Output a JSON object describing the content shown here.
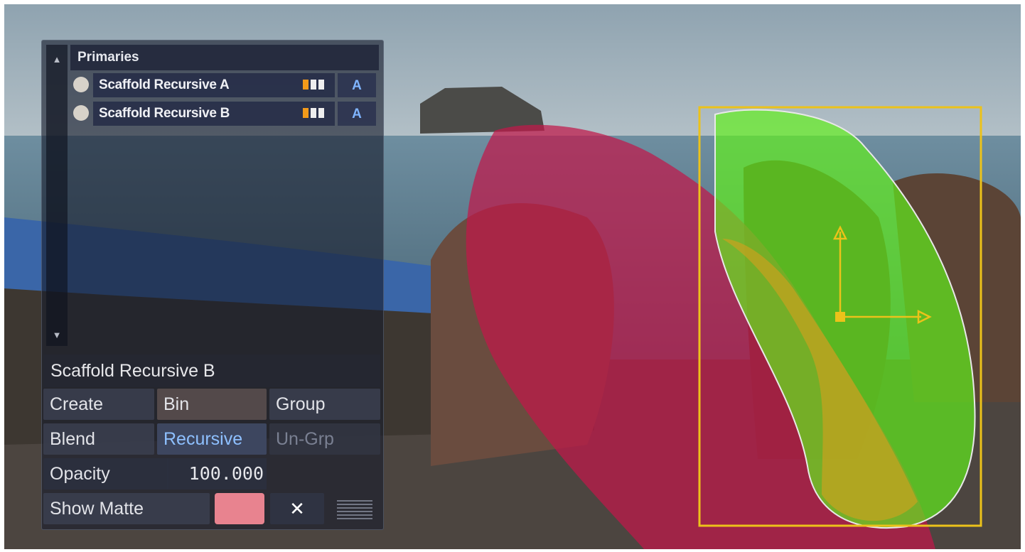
{
  "panel": {
    "list_header": "Primaries",
    "scroll_up_glyph": "▲",
    "scroll_down_glyph": "▼",
    "items": [
      {
        "name": "Scaffold Recursive A",
        "flag": "A",
        "status_icon": "circle-icon",
        "bar_icon": "level-bars-icon"
      },
      {
        "name": "Scaffold Recursive B",
        "flag": "A",
        "status_icon": "circle-icon",
        "bar_icon": "level-bars-icon"
      }
    ],
    "selected_name": "Scaffold Recursive B",
    "buttons": {
      "create": "Create",
      "bin": "Bin",
      "group": "Group",
      "blend": "Blend",
      "recursive": "Recursive",
      "ungroup": "Un-Grp",
      "show_matte": "Show Matte",
      "close_glyph": "✕"
    },
    "opacity": {
      "label": "Opacity",
      "value": "100.000"
    },
    "matte_color": "#e8838f"
  },
  "colors": {
    "accent_blue": "#8ec0ff",
    "bar_orange": "#f29a1a",
    "bar_white": "#eeeeee",
    "shape_red": "#c0174a",
    "shape_green": "#62f21a",
    "shape_yellow": "#c8a21e",
    "box_outline": "#ecc21a"
  }
}
